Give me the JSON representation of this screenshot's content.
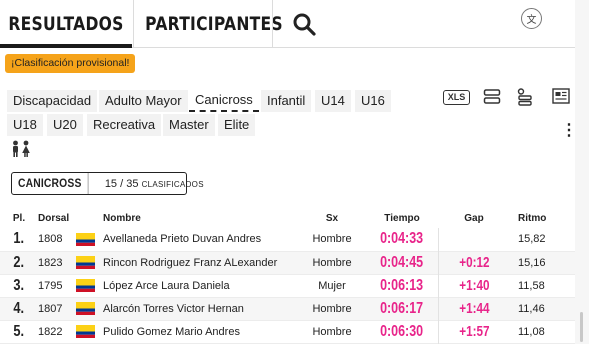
{
  "tabs": {
    "results": "RESULTADOS",
    "participants": "PARTICIPANTES"
  },
  "language_icon_glyph": "文",
  "badge": {
    "text": "¡Clasificación provisional!",
    "color": "#f5a31a"
  },
  "categories": [
    "Discapacidad",
    "Adulto Mayor",
    "Canicross",
    "Infantil",
    "U14",
    "U16",
    "U18",
    "U20",
    "Recreativa",
    "Master",
    "Elite"
  ],
  "active_category": "Canicross",
  "toolbar": {
    "xls_label": "XLS",
    "more_glyph": "⋮"
  },
  "summary": {
    "category": "CANICROSS",
    "shown": "15",
    "separator": "/",
    "total": "35",
    "suffix": "CLASIFICADOS"
  },
  "table": {
    "headers": {
      "pl": "Pl.",
      "dorsal": "Dorsal",
      "name": "Nombre",
      "sx": "Sx",
      "time": "Tiempo",
      "gap": "Gap",
      "ritmo": "Ritmo"
    },
    "rows": [
      {
        "pos": "1.",
        "dorsal": "1808",
        "flag": "colombia-flag-icon",
        "name": "Avellaneda Prieto Duvan Andres",
        "sx": "Hombre",
        "time": "0:04:33",
        "gap": "",
        "ritmo": "15,82"
      },
      {
        "pos": "2.",
        "dorsal": "1823",
        "flag": "colombia-flag-icon",
        "name": "Rincon Rodriguez Franz ALexander",
        "sx": "Hombre",
        "time": "0:04:45",
        "gap": "+0:12",
        "ritmo": "15,16"
      },
      {
        "pos": "3.",
        "dorsal": "1795",
        "flag": "colombia-flag-icon",
        "name": "López Arce Laura Daniela",
        "sx": "Mujer",
        "time": "0:06:13",
        "gap": "+1:40",
        "ritmo": "11,58"
      },
      {
        "pos": "4.",
        "dorsal": "1807",
        "flag": "colombia-flag-icon",
        "name": "Alarcón Torres Victor Hernan",
        "sx": "Hombre",
        "time": "0:06:17",
        "gap": "+1:44",
        "ritmo": "11,46"
      },
      {
        "pos": "5.",
        "dorsal": "1822",
        "flag": "colombia-flag-icon",
        "name": "Pulido Gomez Mario Andres",
        "sx": "Hombre",
        "time": "0:06:30",
        "gap": "+1:57",
        "ritmo": "11,08"
      }
    ]
  },
  "colors": {
    "accent_pink": "#e8248a",
    "flag_yellow": "#fcd116",
    "flag_blue": "#003893",
    "flag_red": "#ce1126"
  }
}
